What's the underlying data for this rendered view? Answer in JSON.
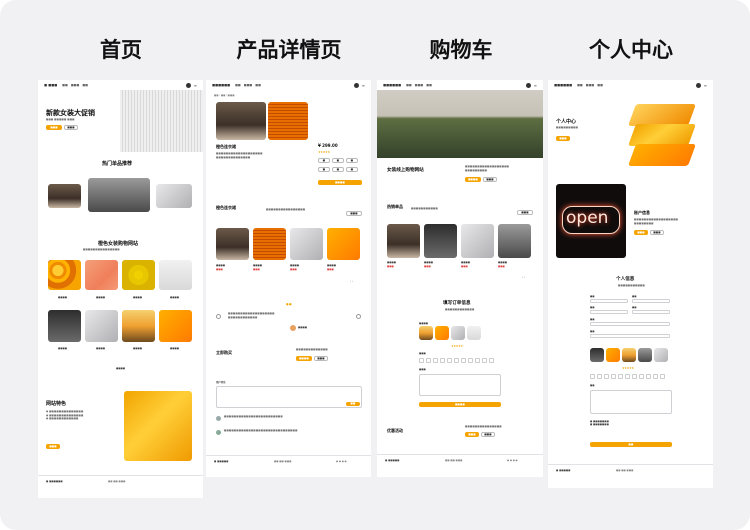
{
  "columns": [
    {
      "title": "首页"
    },
    {
      "title": "产品详情页"
    },
    {
      "title": "购物车"
    },
    {
      "title": "个人中心"
    }
  ],
  "colors": {
    "accent": "#f5a300",
    "board": "#f1f1f3",
    "text": "#111111"
  },
  "home": {
    "hero_title": "新款女装大促销",
    "section_recommend": "热门单品推荐",
    "section_shop": "橙色女装购物网站",
    "section_features": "网站特色"
  },
  "detail": {
    "product_title": "橙色连衣裙",
    "price": "¥ 299.00",
    "section_title": "橙色连衣裙",
    "buy_title": "立即购买",
    "comment_title": "用户评论"
  },
  "cart": {
    "hero_title": "女装线上购物网站",
    "section_hot": "热销单品",
    "form_title": "填写订单信息",
    "promo_title": "优惠活动"
  },
  "profile": {
    "hero_title": "个人中心",
    "account_title": "账户信息",
    "info_title": "个人信息",
    "neon_text": "open"
  }
}
